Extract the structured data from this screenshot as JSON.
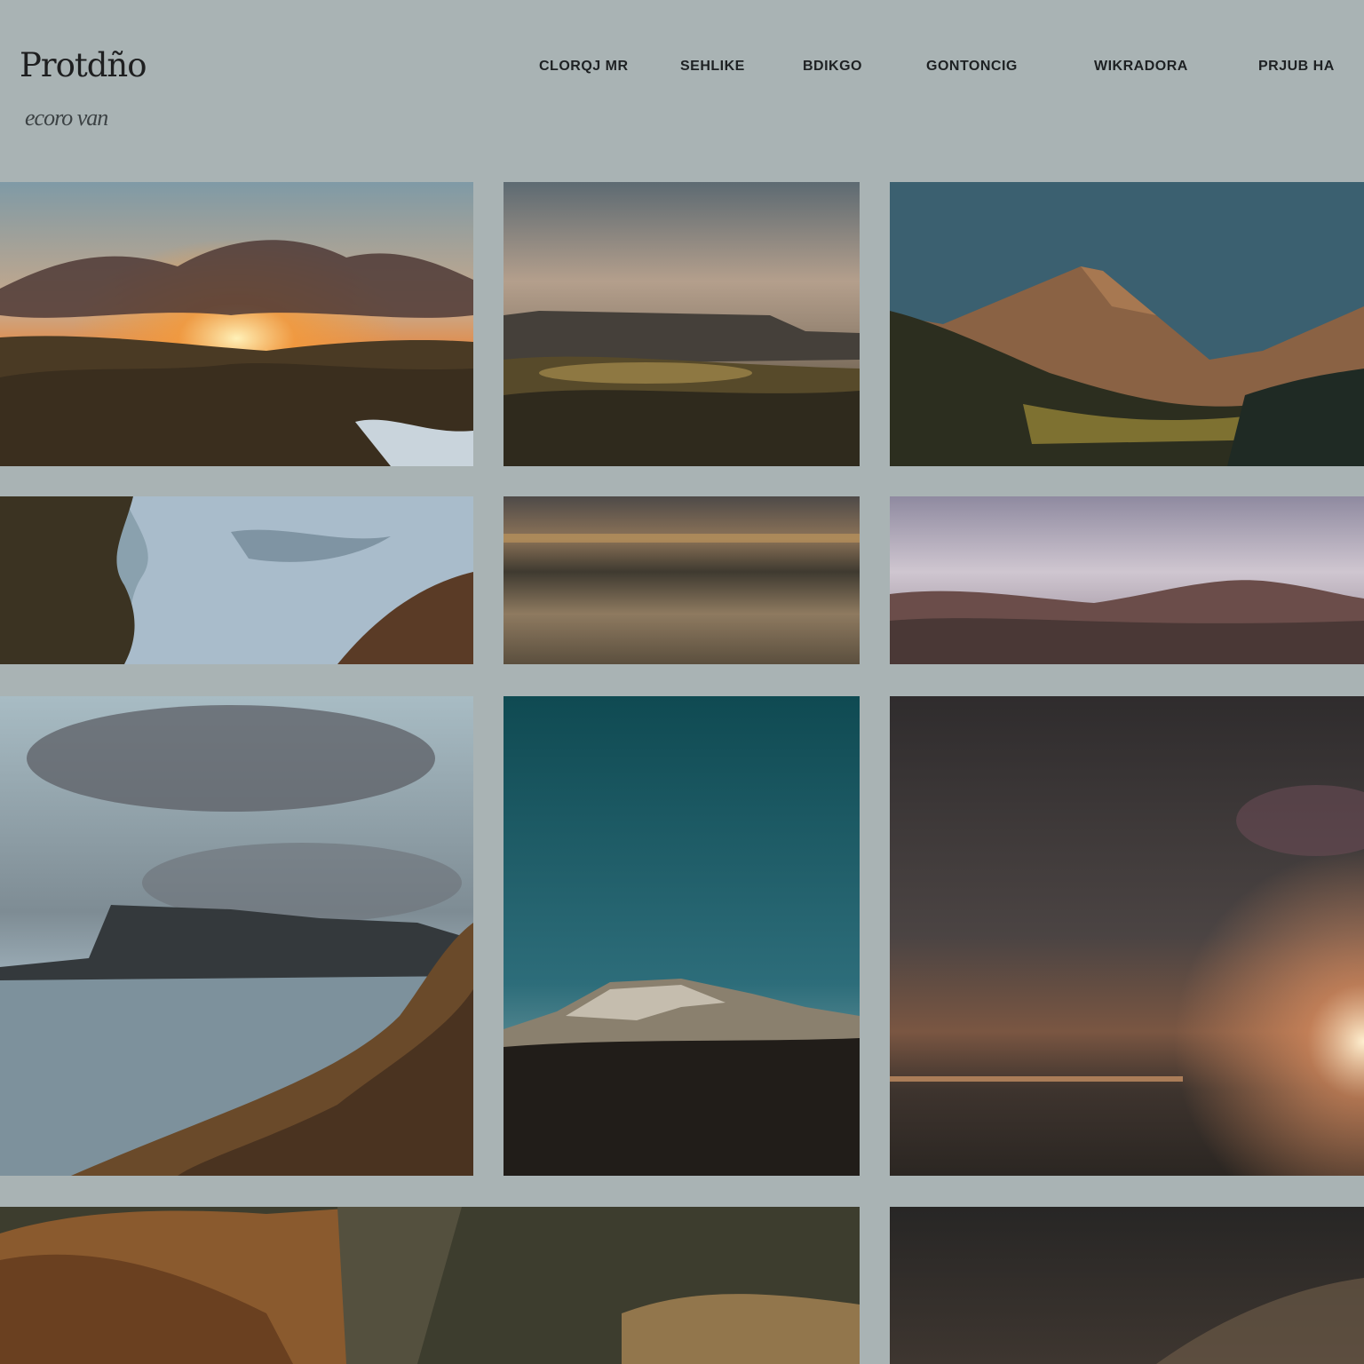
{
  "site": {
    "logo": "Protdño",
    "tagline": "ecoro van"
  },
  "nav": {
    "items": [
      {
        "label": "CLORQJ MR"
      },
      {
        "label": "SEHLIKE"
      },
      {
        "label": "BDIKGO"
      },
      {
        "label": "GONTONCIG"
      },
      {
        "label": "WIKRADORA"
      },
      {
        "label": "PRJUB HA"
      }
    ]
  },
  "gallery": {
    "tiles": [
      {
        "scene": "sunset over moorland with cliff stream"
      },
      {
        "scene": "dusky plateau over golden valley"
      },
      {
        "scene": "sunlit mountain peak"
      },
      {
        "scene": "river through dark banks"
      },
      {
        "scene": "calm lake at golden dusk"
      },
      {
        "scene": "purple clouds over hills"
      },
      {
        "scene": "sea cliffs under stormy sky"
      },
      {
        "scene": "snowy ridge under teal sky"
      },
      {
        "scene": "dark sunset over plains"
      },
      {
        "scene": "rocky golden hillside"
      },
      {
        "scene": "dark moorland at dusk"
      }
    ]
  },
  "colors": {
    "page_background": "#a9b3b4",
    "text": "#1e2123"
  }
}
